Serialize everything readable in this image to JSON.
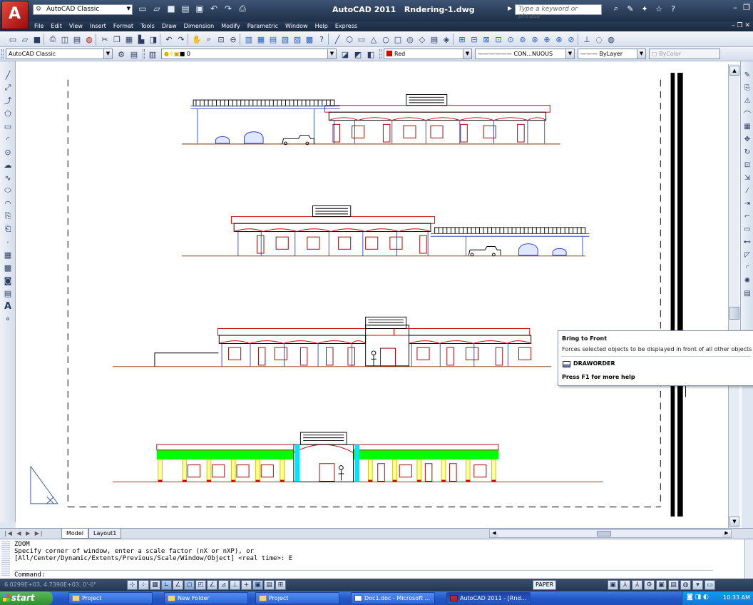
{
  "titlebar": {
    "workspace": "AutoCAD Classic",
    "app_name": "AutoCAD 2011",
    "file_name": "Rndering-1.dwg",
    "search_placeholder": "Type a keyword or phrase"
  },
  "menu": {
    "items": [
      "File",
      "Edit",
      "View",
      "Insert",
      "Format",
      "Tools",
      "Draw",
      "Dimension",
      "Modify",
      "Parametric",
      "Window",
      "Help",
      "Express"
    ]
  },
  "toolbar2": {
    "workspace_combo": "AutoCAD Classic",
    "layer_combo": "0",
    "color_combo": "Red",
    "linetype_combo": "CON...NUOUS",
    "lineweight_combo": "ByLayer",
    "plotstyle_combo": "ByColor"
  },
  "tooltip": {
    "title": "Bring to Front",
    "description": "Forces selected objects to be displayed in front of all other objects",
    "command": "DRAWORDER",
    "help": "Press F1 for more help"
  },
  "tabs": {
    "model": "Model",
    "layout1": "Layout1"
  },
  "command_line": {
    "history": "ZOOM\nSpecify corner of window, enter a scale factor (nX or nXP), or\n[All/Center/Dynamic/Extents/Previous/Scale/Window/Object] <real time>: E",
    "prompt": "Command:"
  },
  "status": {
    "coords": "6.0299E+03, 4.7390E+03, 0'-0\"",
    "paper": "PAPER"
  },
  "taskbar": {
    "start": "start",
    "tasks": [
      "Project",
      "New Folder",
      "Project",
      "Doc1.doc - Microsoft ...",
      "AutoCAD 2011 - [Rnd..."
    ],
    "clock": "10:33 AM"
  },
  "colors": {
    "accent_red": "#d40000",
    "facade_green": "#00ff00",
    "facade_cyan": "#00e5ff",
    "facade_yellow": "#ffff99"
  }
}
